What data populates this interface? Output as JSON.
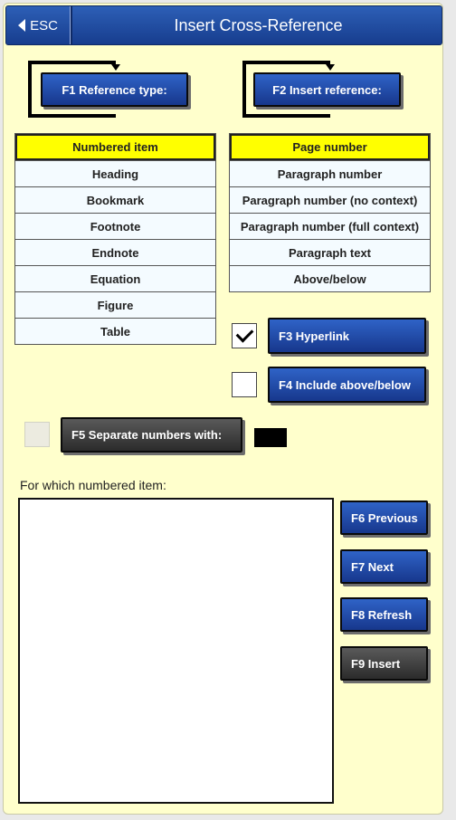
{
  "header": {
    "esc_label": "ESC",
    "title": "Insert Cross-Reference"
  },
  "buttons": {
    "f1": "F1 Reference type:",
    "f2": "F2 Insert reference:",
    "f3": "F3 Hyperlink",
    "f4": "F4 Include above/below",
    "f5": "F5 Separate numbers with:",
    "f6": "F6 Previous",
    "f7": "F7 Next",
    "f8": "F8 Refresh",
    "f9": "F9 Insert"
  },
  "reference_types": {
    "selected": "Numbered item",
    "items": [
      "Numbered item",
      "Heading",
      "Bookmark",
      "Footnote",
      "Endnote",
      "Equation",
      "Figure",
      "Table"
    ]
  },
  "insert_reference": {
    "selected": "Page number",
    "items": [
      "Page number",
      "Paragraph number",
      "Paragraph number (no context)",
      "Paragraph number (full context)",
      "Paragraph text",
      "Above/below"
    ]
  },
  "options": {
    "hyperlink_checked": true,
    "include_above_below_checked": false,
    "separate_numbers_enabled": false
  },
  "numbered_item_label": "For which numbered item:",
  "numbered_items": []
}
